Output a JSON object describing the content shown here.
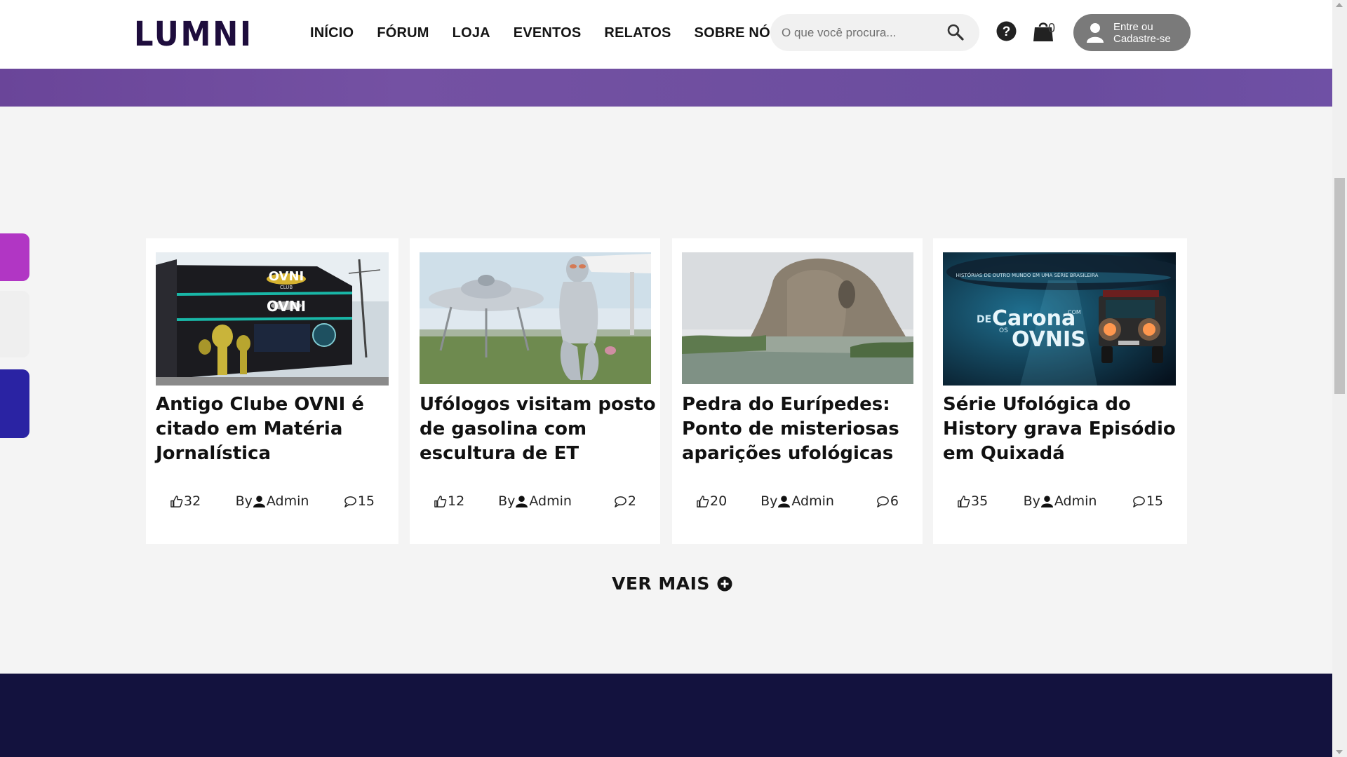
{
  "header": {
    "logo_text": "LUMNI",
    "nav": [
      "INÍCIO",
      "FÓRUM",
      "LOJA",
      "EVENTOS",
      "RELATOS",
      "SOBRE NÓS"
    ],
    "search_placeholder": "O que você procura...",
    "cart_count": "0",
    "login_label": "Entre ou Cadastre-se"
  },
  "colors": {
    "banner": "#6f4fa0",
    "footer": "#13123e",
    "side_tab_1": "#b136c4",
    "side_tab_2": "#efefef",
    "side_tab_3": "#2a23a3"
  },
  "cards": [
    {
      "title": "Antigo Clube OVNI é citado em Matéria Jornalística",
      "likes": "32",
      "by": "By",
      "author": "Admin",
      "comments": "15",
      "image_sign_top": "OVNI",
      "image_sign_sub": "CLUB",
      "image_sign_main": "OVNI"
    },
    {
      "title": "Ufólogos visitam posto de gasolina com escultura de ET",
      "likes": "12",
      "by": "By",
      "author": "Admin",
      "comments": "2"
    },
    {
      "title": "Pedra do Eurípedes: Ponto de misteriosas aparições ufológicas",
      "likes": "20",
      "by": "By",
      "author": "Admin",
      "comments": "6"
    },
    {
      "title": "Série Ufológica do History grava Episódio em Quixadá",
      "likes": "35",
      "by": "By",
      "author": "Admin",
      "comments": "15",
      "image_caption": "HISTÓRIAS DE OUTRO MUNDO EM UMA SÉRIE BRASILEIRA",
      "image_show_de": "DE",
      "image_show_carona": "Carona",
      "image_show_com": "COM",
      "image_show_os": "OS",
      "image_show_ovnis": "OVNIS"
    }
  ],
  "ver_mais_label": "VER MAIS"
}
